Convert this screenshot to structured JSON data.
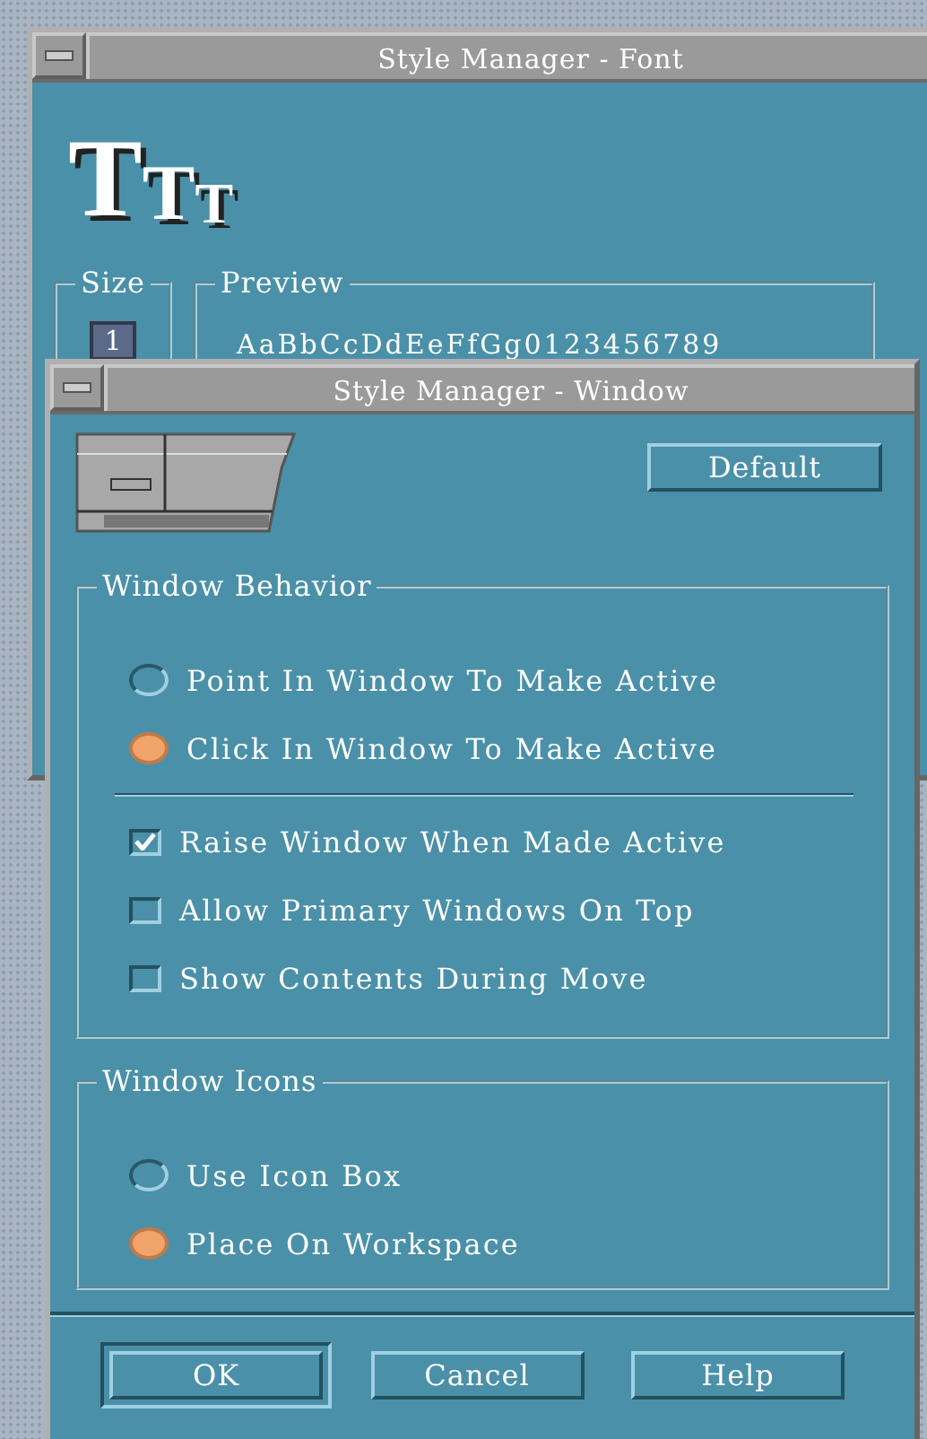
{
  "font_window": {
    "title": "Style Manager - Font",
    "icon_letters": [
      "T",
      "T",
      "T"
    ],
    "size_group": {
      "label": "Size",
      "items": [
        {
          "label": "1",
          "selected": true
        }
      ]
    },
    "preview_group": {
      "label": "Preview",
      "sample": "AaBbCcDdEeFfGg0123456789"
    }
  },
  "window_dialog": {
    "title": "Style Manager - Window",
    "default_button": "Default",
    "behavior_group": {
      "label": "Window Behavior",
      "focus_options": [
        {
          "label": "Point In Window To Make Active",
          "selected": false
        },
        {
          "label": "Click In Window To Make Active",
          "selected": true
        }
      ],
      "checkboxes": [
        {
          "label": "Raise Window When Made Active",
          "checked": true
        },
        {
          "label": "Allow Primary Windows On Top",
          "checked": false
        },
        {
          "label": "Show Contents During Move",
          "checked": false
        }
      ]
    },
    "icons_group": {
      "label": "Window Icons",
      "options": [
        {
          "label": "Use Icon Box",
          "selected": false
        },
        {
          "label": "Place On Workspace",
          "selected": true
        }
      ]
    },
    "buttons": [
      {
        "label": "OK",
        "default": true
      },
      {
        "label": "Cancel",
        "default": false
      },
      {
        "label": "Help",
        "default": false
      }
    ]
  }
}
